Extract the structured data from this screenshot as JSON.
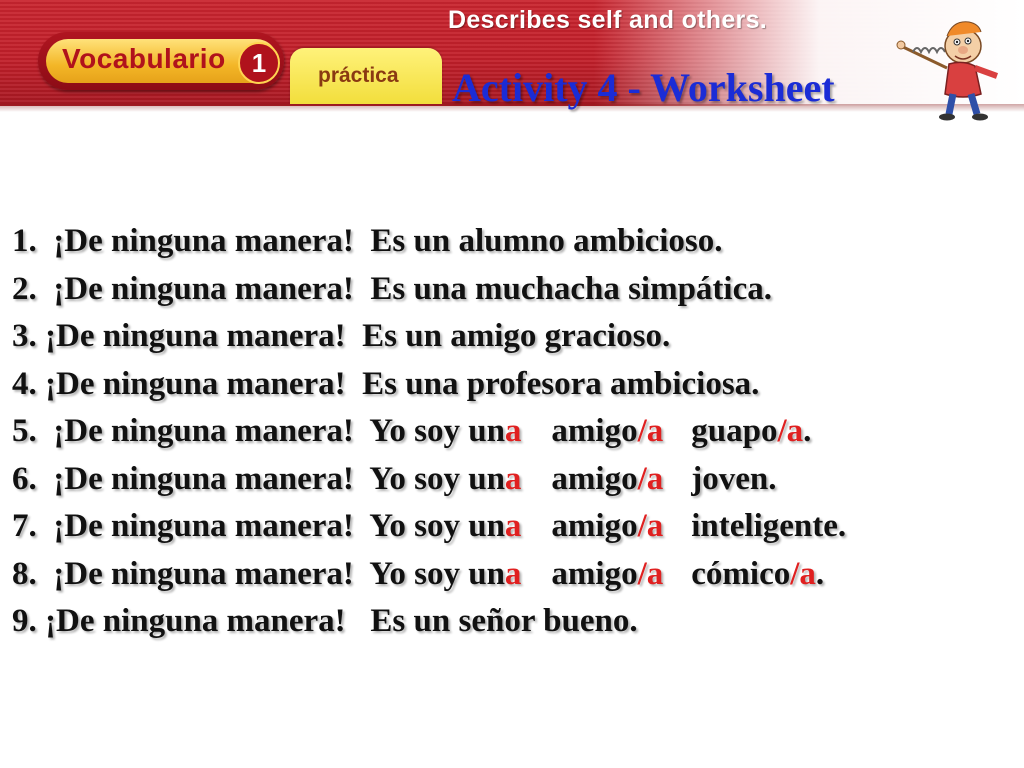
{
  "header": {
    "tagline": "Describes self and others.",
    "vocab_label": "Vocabulario",
    "vocab_number": "1",
    "practica_label": "práctica",
    "title": "Activity 4 - Worksheet",
    "banner_color": "#c21f2a",
    "title_color": "#1b2cd6",
    "mascot_icon": "pointing-cartoon-man"
  },
  "accent_color": "#e02020",
  "sentences": [
    {
      "number": "1.",
      "text": "  ¡De ninguna manera!  Es un alumno ambicioso."
    },
    {
      "number": "2.",
      "text": "  ¡De ninguna manera!  Es una muchacha simpática."
    },
    {
      "number": "3.",
      "text": " ¡De ninguna manera!  Es un amigo gracioso."
    },
    {
      "number": "4.",
      "text": " ¡De ninguna manera!  Es una profesora ambiciosa."
    },
    {
      "number": "5.",
      "lead": "  ¡De ninguna manera!  Yo soy un",
      "a1": "a",
      "w2": "amigo",
      "a2": "/a",
      "w3": "guapo",
      "a3": "/a",
      "tail": "."
    },
    {
      "number": "6.",
      "lead": "  ¡De ninguna manera!  Yo soy un",
      "a1": "a",
      "w2": "amigo",
      "a2": "/a",
      "w3": "joven."
    },
    {
      "number": "7.",
      "lead": "  ¡De ninguna manera!  Yo soy un",
      "a1": "a",
      "w2": "amigo",
      "a2": "/a",
      "w3": "inteligente."
    },
    {
      "number": "8.",
      "lead": "  ¡De ninguna manera!  Yo soy un",
      "a1": "a",
      "w2": "amigo",
      "a2": "/a",
      "w3": "cómico",
      "a3": "/a",
      "tail": "."
    },
    {
      "number": "9.",
      "text": " ¡De ninguna manera!   Es un señor bueno."
    }
  ]
}
